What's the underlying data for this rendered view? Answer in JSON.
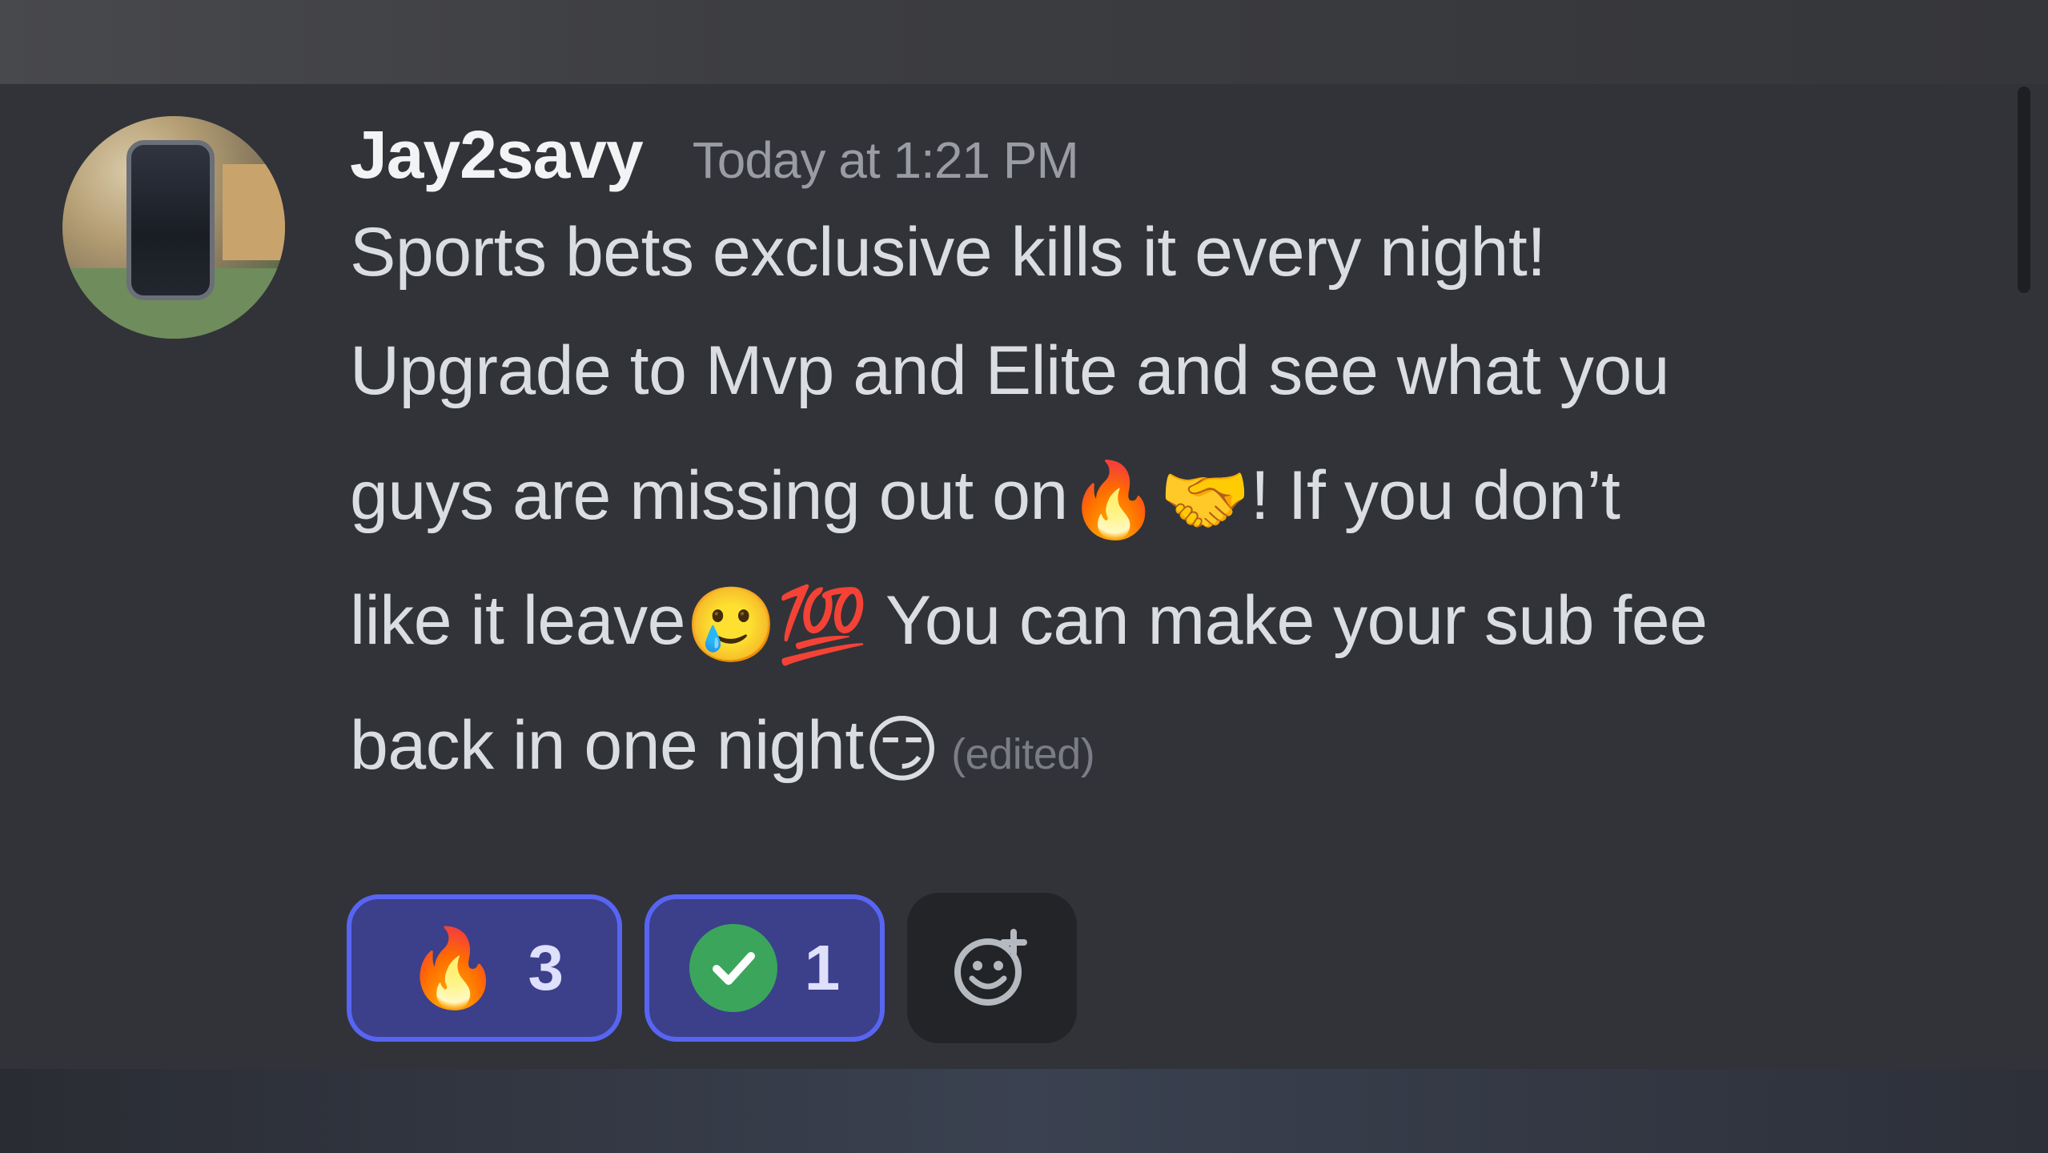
{
  "message": {
    "author": "Jay2savy",
    "timestamp": "Today at 1:21 PM",
    "lines": [
      {
        "text": "Sports bets exclusive kills it every night!"
      },
      {
        "text": "Upgrade to Mvp and Elite and see what you"
      },
      {
        "pre": "guys are missing out on",
        "emoji1": "🔥",
        "emoji2": "🤝",
        "post": "! If you don’t"
      },
      {
        "pre": "like it leave",
        "emoji1": "🥲",
        "emoji2": "💯",
        "post": " You can make your sub fee"
      },
      {
        "pre": "back in one night",
        "emoji1": "😏"
      }
    ],
    "edited_label": "(edited)"
  },
  "reactions": [
    {
      "emoji": "🔥",
      "count": "3",
      "icon": "fire-icon"
    },
    {
      "emoji": "✓",
      "count": "1",
      "icon": "verified-check-icon"
    }
  ],
  "add_reaction": {
    "icon": "add-reaction-icon"
  },
  "colors": {
    "background": "#313338",
    "username": "#f2f3f5",
    "timestamp": "#9a9ca3",
    "message_text": "#dbdee1",
    "reaction_bg": "#3c3f8a",
    "reaction_border": "#5865f2",
    "check_green": "#3ba55c"
  }
}
